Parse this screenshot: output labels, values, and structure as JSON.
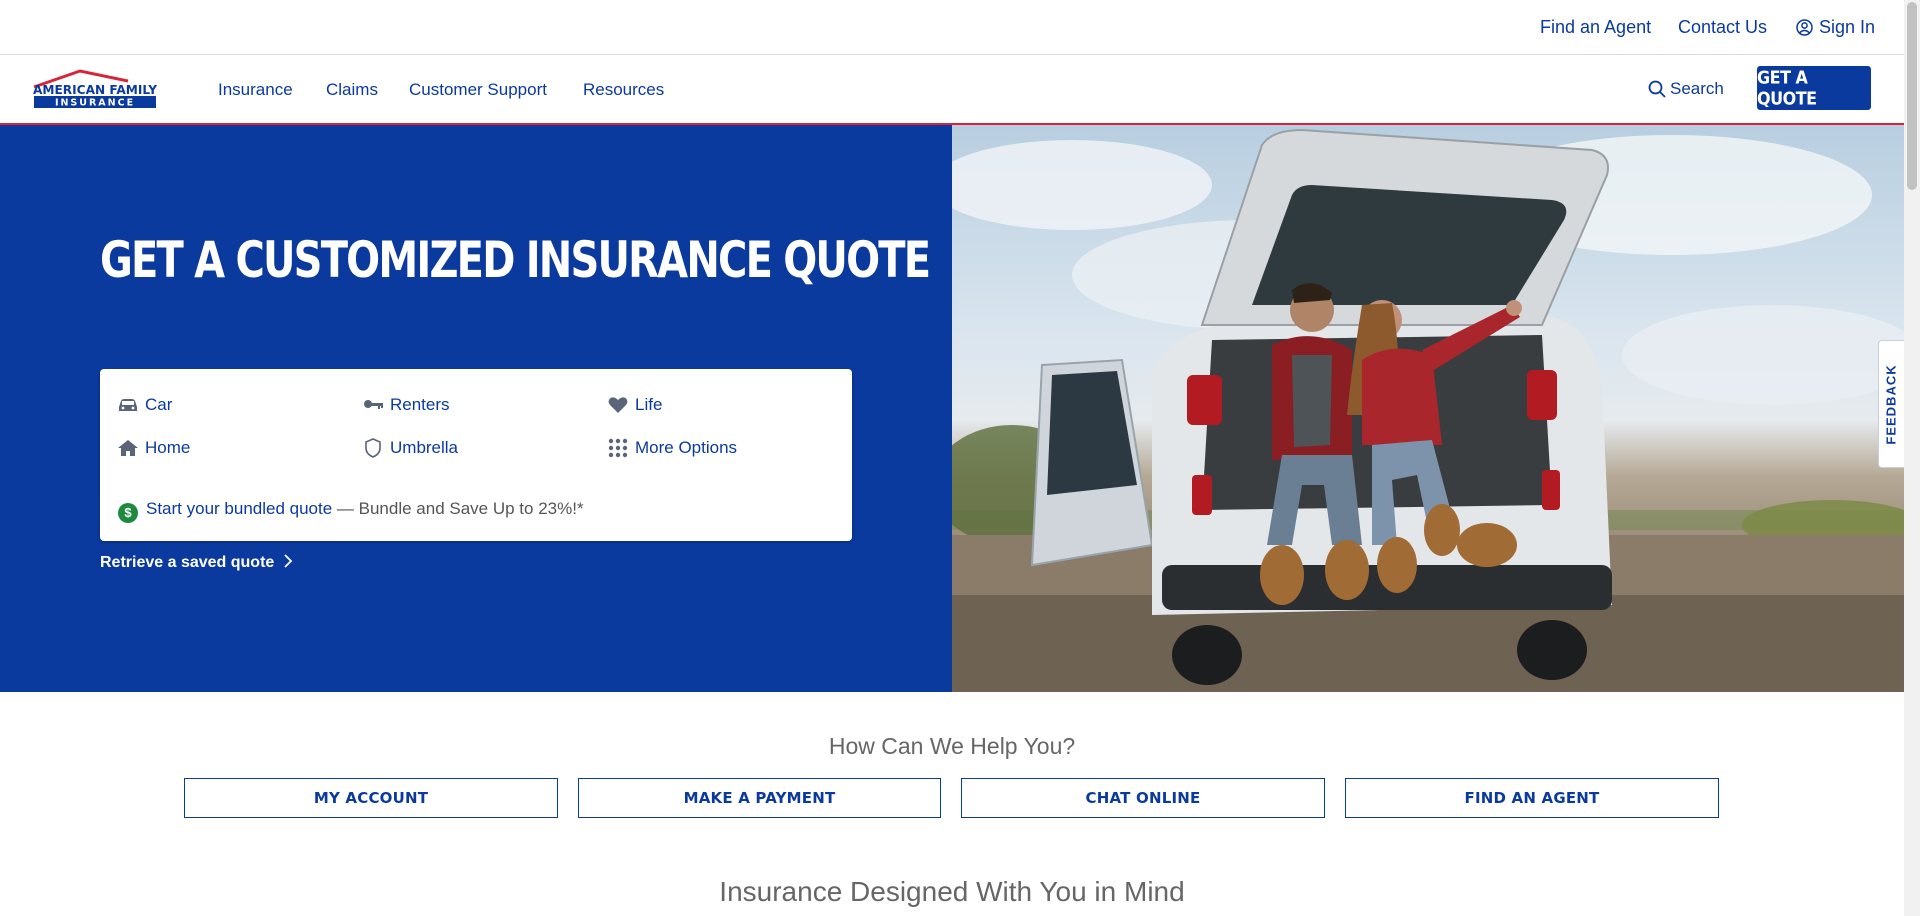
{
  "utility": {
    "find_agent": "Find an Agent",
    "contact_us": "Contact Us",
    "sign_in": "Sign In"
  },
  "nav": {
    "logo_alt": "American Family Insurance",
    "logo_line1": "AMERICAN FAMILY",
    "logo_line2": "INSURANCE",
    "items": [
      "Insurance",
      "Claims",
      "Customer Support",
      "Resources"
    ],
    "search": "Search",
    "get_quote": "GET A QUOTE"
  },
  "hero": {
    "title": "GET A CUSTOMIZED INSURANCE QUOTE",
    "options": [
      {
        "label": "Car",
        "icon": "car-icon"
      },
      {
        "label": "Renters",
        "icon": "key-icon"
      },
      {
        "label": "Life",
        "icon": "heart-icon"
      },
      {
        "label": "Home",
        "icon": "house-icon"
      },
      {
        "label": "Umbrella",
        "icon": "shield-icon"
      },
      {
        "label": "More Options",
        "icon": "grid-icon"
      }
    ],
    "bundle_link": "Start your bundled quote",
    "bundle_tagline": " — Bundle and Save Up to 23%!*",
    "bundle_icon_glyph": "$",
    "retrieve": "Retrieve a saved quote"
  },
  "feedback": "FEEDBACK",
  "help": {
    "title": "How Can We Help You?",
    "buttons": [
      "MY ACCOUNT",
      "MAKE A PAYMENT",
      "CHAT ONLINE",
      "FIND AN AGENT"
    ]
  },
  "designed": {
    "title": "Insurance Designed With You in Mind"
  },
  "colors": {
    "brand_blue": "#0b3a9e",
    "brand_red": "#d6243a",
    "bundle_green": "#1e8a3e"
  }
}
